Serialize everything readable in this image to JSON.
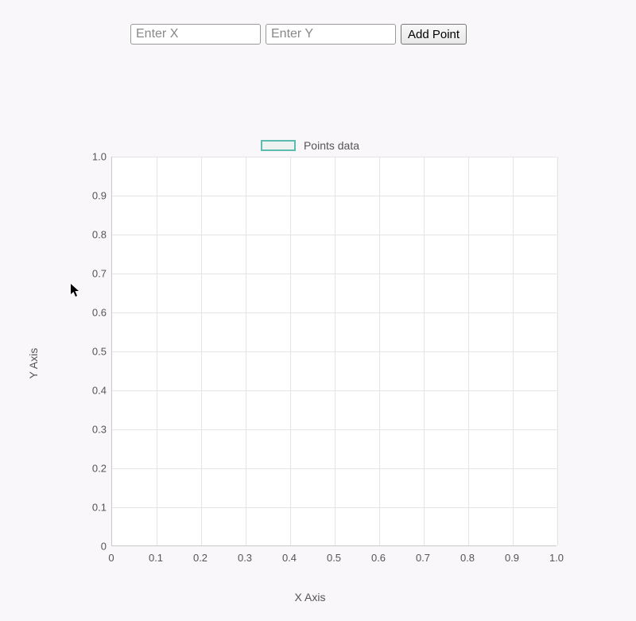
{
  "controls": {
    "x_placeholder": "Enter X",
    "y_placeholder": "Enter Y",
    "x_value": "",
    "y_value": "",
    "add_button_label": "Add Point"
  },
  "chart_data": {
    "type": "scatter",
    "title": "",
    "legend": "Points data",
    "series": [
      {
        "name": "Points data",
        "points": []
      }
    ],
    "xlabel": "X Axis",
    "ylabel": "Y Axis",
    "xlim": [
      0,
      1.0
    ],
    "ylim": [
      0,
      1.0
    ],
    "x_ticks": [
      "0",
      "0.1",
      "0.2",
      "0.3",
      "0.4",
      "0.5",
      "0.6",
      "0.7",
      "0.8",
      "0.9",
      "1.0"
    ],
    "y_ticks": [
      "0",
      "0.1",
      "0.2",
      "0.3",
      "0.4",
      "0.5",
      "0.6",
      "0.7",
      "0.8",
      "0.9",
      "1.0"
    ],
    "grid": true,
    "colors": {
      "series_fill": "#eef2f1",
      "series_stroke": "#5dbcb0"
    }
  }
}
